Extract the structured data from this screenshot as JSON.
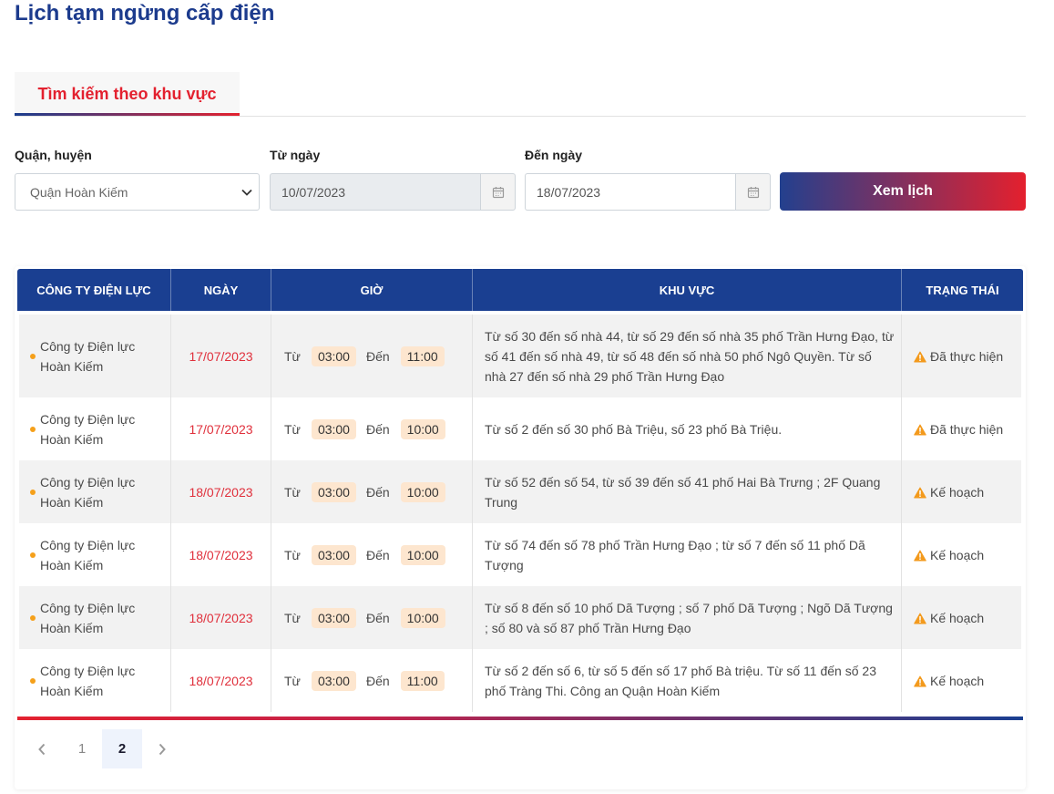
{
  "page": {
    "title": "Lịch tạm ngừng cấp điện"
  },
  "tabs": [
    {
      "label": "Tìm kiếm theo khu vực",
      "active": true
    }
  ],
  "filters": {
    "district": {
      "label": "Quận, huyện",
      "value": "Quận Hoàn Kiếm",
      "icon": "chevron-down-icon"
    },
    "from_date": {
      "label": "Từ ngày",
      "value": "10/07/2023",
      "disabled": true,
      "icon": "calendar-icon"
    },
    "to_date": {
      "label": "Đến ngày",
      "value": "18/07/2023",
      "icon": "calendar-icon"
    },
    "submit": {
      "label": "Xem lịch"
    }
  },
  "table": {
    "headers": {
      "company": "CÔNG TY ĐIỆN LỰC",
      "date": "NGÀY",
      "time": "GIỜ",
      "area": "KHU VỰC",
      "status": "TRẠNG THÁI"
    },
    "time_labels": {
      "from": "Từ",
      "to": "Đến"
    },
    "rows": [
      {
        "company": "Công ty Điện lực Hoàn Kiếm",
        "date": "17/07/2023",
        "from": "03:00",
        "to": "11:00",
        "area": "Từ số 30 đến số nhà 44, từ số 29 đến số nhà 35 phố Trần Hưng Đạo, từ số 41 đến số nhà 49, từ số 48 đến số nhà 50 phố Ngô Quyền. Từ số nhà 27 đến số nhà 29 phố Trần Hưng Đạo",
        "status": "Đã thực hiện",
        "status_icon": "warning-icon"
      },
      {
        "company": "Công ty Điện lực Hoàn Kiếm",
        "date": "17/07/2023",
        "from": "03:00",
        "to": "10:00",
        "area": "Từ số 2 đến số 30 phố Bà Triệu, số 23 phố Bà Triệu.",
        "status": "Đã thực hiện",
        "status_icon": "warning-icon"
      },
      {
        "company": "Công ty Điện lực Hoàn Kiếm",
        "date": "18/07/2023",
        "from": "03:00",
        "to": "10:00",
        "area": "Từ số 52 đến số 54, từ số 39 đến số 41 phố Hai Bà Trưng ; 2F Quang Trung",
        "status": "Kế hoạch",
        "status_icon": "warning-icon"
      },
      {
        "company": "Công ty Điện lực Hoàn Kiếm",
        "date": "18/07/2023",
        "from": "03:00",
        "to": "10:00",
        "area": "Từ số 74 đến số 78 phố Trần Hưng Đạo ; từ số 7 đến số 11 phố Dã Tượng",
        "status": "Kế hoạch",
        "status_icon": "warning-icon"
      },
      {
        "company": "Công ty Điện lực Hoàn Kiếm",
        "date": "18/07/2023",
        "from": "03:00",
        "to": "10:00",
        "area": "Từ số 8 đến số 10 phố Dã Tượng ; số 7 phố Dã Tượng ; Ngõ Dã Tượng ; số 80 và số 87 phố Trần Hưng Đạo",
        "status": "Kế hoạch",
        "status_icon": "warning-icon"
      },
      {
        "company": "Công ty Điện lực Hoàn Kiếm",
        "date": "18/07/2023",
        "from": "03:00",
        "to": "11:00",
        "area": "Từ số 2 đến số 6, từ số 5 đến số 17 phố Bà triệu. Từ số 11 đến số 23 phố Tràng Thi. Công an Quận Hoàn Kiếm",
        "status": "Kế hoạch",
        "status_icon": "warning-icon"
      }
    ]
  },
  "pagination": {
    "prev_icon": "chevron-left-icon",
    "next_icon": "chevron-right-icon",
    "pages": [
      {
        "label": "1",
        "active": false
      },
      {
        "label": "2",
        "active": true
      }
    ]
  },
  "colors": {
    "title": "#1c3b8d",
    "tab_active": "#e3212f",
    "header_bg": "#1a3f91",
    "date_text": "#e0303c",
    "time_badge_bg": "#fde6cf",
    "warning_icon": "#f39a1d",
    "company_dot": "#f5a01a",
    "row_alt_bg": "#f2f2f2"
  }
}
